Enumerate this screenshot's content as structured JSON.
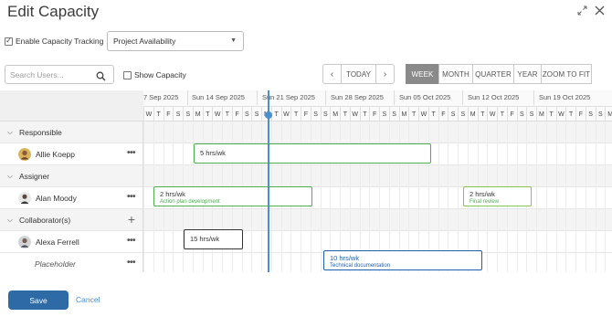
{
  "title": "Edit Capacity",
  "header_icons": {
    "expand": "↙↗",
    "close": "✕"
  },
  "options": {
    "enable_capacity_tracking_label": "Enable Capacity Tracking",
    "enable_capacity_tracking_checked": true,
    "view_select_value": "Project Availability"
  },
  "search": {
    "placeholder": "Search Users..."
  },
  "show_capacity": {
    "label": "Show Capacity",
    "checked": false
  },
  "nav": {
    "prev": "‹",
    "today": "TODAY",
    "next": "›"
  },
  "zoom_buttons": [
    {
      "label": "WEEK",
      "active": true
    },
    {
      "label": "MONTH",
      "active": false
    },
    {
      "label": "QUARTER",
      "active": false
    },
    {
      "label": "YEAR",
      "active": false
    },
    {
      "label": "ZOOM TO FIT",
      "active": false
    }
  ],
  "timeline": {
    "week_labels": [
      "7 Sep 2025",
      "Sun 14 Sep 2025",
      "Sun 21 Sep 2025",
      "Sun 28 Sep 2025",
      "Sun 05 Oct 2025",
      "Sun 12 Oct 2025",
      "Sun 19 Oct 2025"
    ],
    "day_letters": [
      "W",
      "T",
      "F",
      "S",
      "S",
      "M",
      "T",
      "W",
      "T",
      "F",
      "S",
      "S",
      "M",
      "T",
      "W",
      "T",
      "F",
      "S",
      "S",
      "M",
      "T",
      "W",
      "T",
      "F",
      "S",
      "S",
      "M",
      "T",
      "W",
      "T",
      "F",
      "S",
      "S",
      "M",
      "T",
      "W",
      "T",
      "F",
      "S",
      "S",
      "M",
      "T",
      "W",
      "T",
      "F",
      "S",
      "S",
      "M",
      "T",
      "W"
    ]
  },
  "groups": [
    {
      "label": "Responsible"
    },
    {
      "label": "Assigner"
    },
    {
      "label": "Collaborator(s)"
    }
  ],
  "people": [
    {
      "name": "Allie Koepp"
    },
    {
      "name": "Alan Moody"
    },
    {
      "name": "Alexa Ferrell"
    },
    {
      "name": "Placeholder"
    }
  ],
  "row_menu": "•••",
  "add_collaborator": "+",
  "bars": [
    {
      "hours": "5 hrs/wk",
      "desc": ""
    },
    {
      "hours": "2 hrs/wk",
      "desc": "Action plan development"
    },
    {
      "hours": "2 hrs/wk",
      "desc": "Final review"
    },
    {
      "hours": "15 hrs/wk",
      "desc": ""
    },
    {
      "hours": "10 hrs/wk",
      "desc": "Technical documentation"
    }
  ],
  "colors": {
    "primary": "#2d6aa6",
    "today": "#4a8fd0",
    "green": "#4caf50",
    "blue": "#1e5fb0"
  },
  "footer": {
    "save": "Save",
    "cancel": "Cancel"
  }
}
